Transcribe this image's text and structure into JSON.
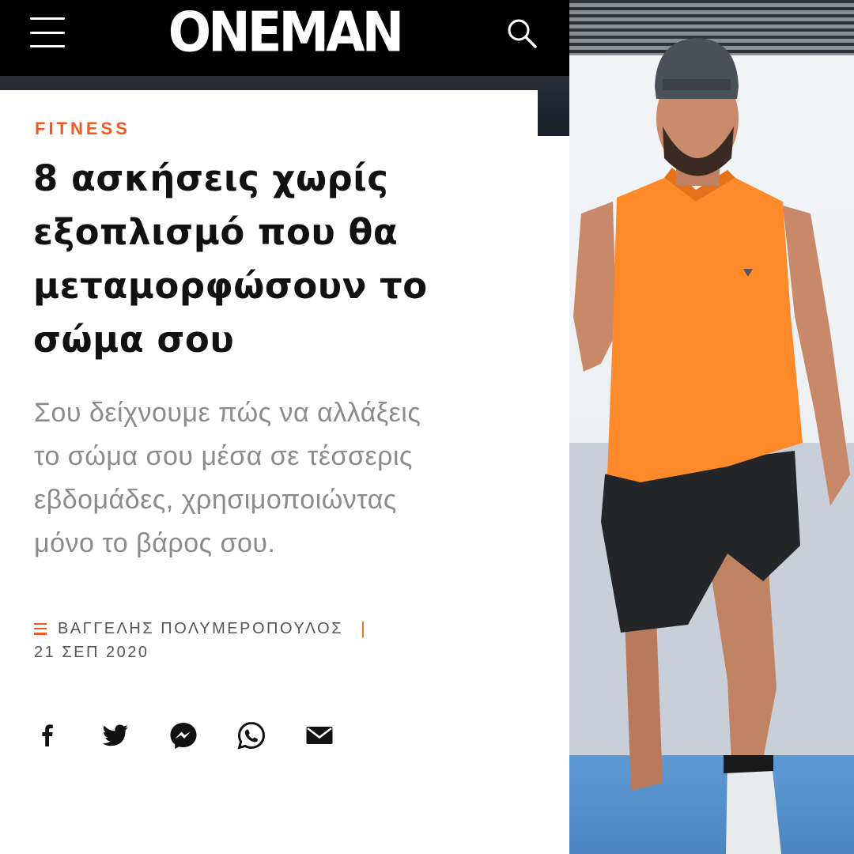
{
  "header": {
    "logo_text": "ONEMAN",
    "menu_icon": "hamburger-menu-icon",
    "search_icon": "search-icon"
  },
  "article": {
    "category": "FITNESS",
    "headline_lines": [
      "8 ασκήσεις χωρίς",
      "εξοπλισμό που θα",
      "μεταμορφώσουν το",
      "σώμα σου"
    ],
    "subtitle_lines": [
      "Σου δείχνουμε πώς να αλλάξεις",
      "το σώμα σου μέσα σε τέσσερις",
      "εβδομάδες, χρησιμοποιώντας",
      "μόνο το βάρος σου."
    ],
    "author": "ΒΑΓΓΕΛΗΣ ΠΟΛΥΜΕΡΟΠΟΥΛΟΣ",
    "separator": "|",
    "date": "21 ΣΕΠ 2020"
  },
  "share": {
    "facebook": "f",
    "icons": [
      "facebook-icon",
      "twitter-icon",
      "messenger-icon",
      "whatsapp-icon",
      "email-icon"
    ]
  },
  "colors": {
    "accent": "#ef5b22",
    "header_bg": "#000000",
    "headline": "#111111",
    "subtitle": "#8b8b8b",
    "shirt": "#ff8a2a"
  }
}
